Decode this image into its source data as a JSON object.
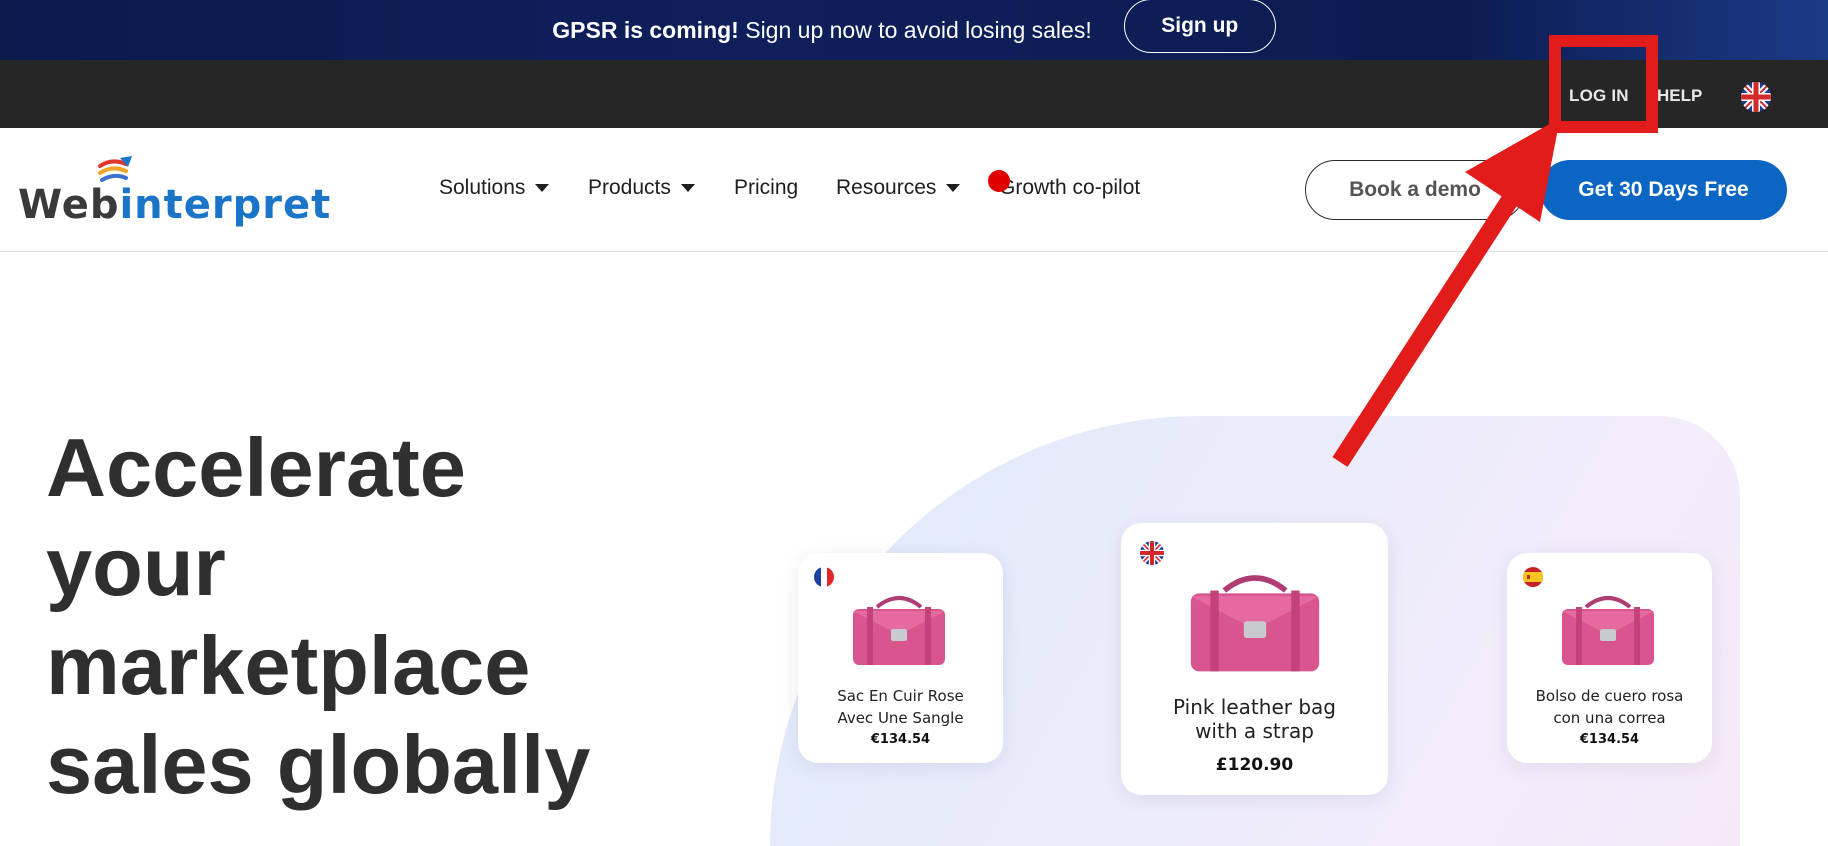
{
  "announcement": {
    "bold_text": "GPSR is coming!",
    "text": " Sign up now to avoid losing sales!",
    "button_label": "Sign up"
  },
  "utility_bar": {
    "login_label": "LOG IN",
    "help_label": "HELP",
    "language_icon": "uk-flag-icon"
  },
  "brand": {
    "logo_part1": "Web",
    "logo_part2": "interpret",
    "accent_color": "#1a74c8"
  },
  "nav": {
    "items": [
      {
        "label": "Solutions",
        "dropdown": true
      },
      {
        "label": "Products",
        "dropdown": true
      },
      {
        "label": "Pricing",
        "dropdown": false
      },
      {
        "label": "Resources",
        "dropdown": true
      },
      {
        "label": "Growth co-pilot",
        "dropdown": false
      }
    ],
    "demo_button": "Book a demo",
    "trial_button": "Get 30 Days Free",
    "primary_color": "#0a66c2"
  },
  "hero": {
    "title_lines": [
      "Accelerate",
      "your",
      "marketplace",
      "sales globally"
    ]
  },
  "products": [
    {
      "flag": "france-flag-icon",
      "title_line1": "Sac En Cuir Rose",
      "title_line2": "Avec Une Sangle",
      "price": "€134.54"
    },
    {
      "flag": "uk-flag-icon",
      "title_line1": "Pink leather bag",
      "title_line2": "with a strap",
      "price": "£120.90"
    },
    {
      "flag": "spain-flag-icon",
      "title_line1": "Bolso de cuero rosa",
      "title_line2": "con una correa",
      "price": "€134.54"
    }
  ],
  "annotation": {
    "color": "#e21b1b"
  }
}
